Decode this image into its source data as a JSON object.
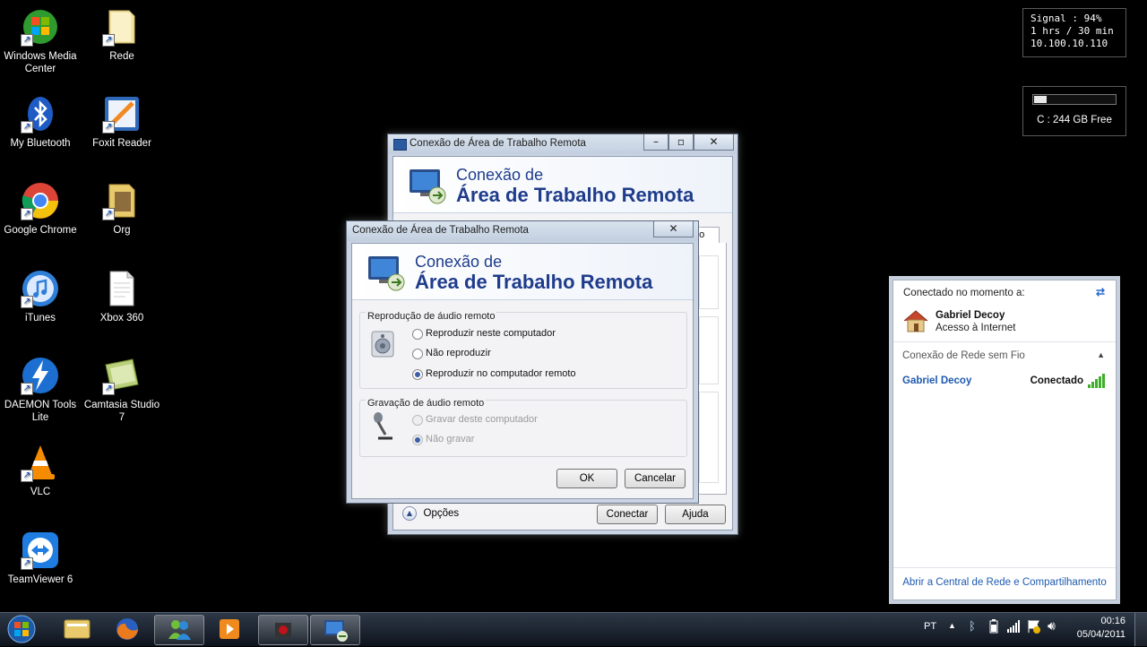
{
  "desktop": {
    "icons": [
      {
        "label": "Windows Media\nCenter",
        "icon": "windows-media-center-icon"
      },
      {
        "label": "Rede",
        "icon": "network-folder-icon"
      },
      {
        "label": "My Bluetooth",
        "icon": "bluetooth-icon"
      },
      {
        "label": "Foxit Reader",
        "icon": "foxit-reader-icon"
      },
      {
        "label": "Google Chrome",
        "icon": "chrome-icon"
      },
      {
        "label": "Org",
        "icon": "folder-icon"
      },
      {
        "label": "iTunes",
        "icon": "itunes-icon"
      },
      {
        "label": "Xbox 360",
        "icon": "document-icon"
      },
      {
        "label": "DAEMON Tools\nLite",
        "icon": "daemon-tools-icon"
      },
      {
        "label": "Camtasia Studio\n7",
        "icon": "camtasia-icon"
      },
      {
        "label": "VLC",
        "icon": "vlc-icon"
      },
      {
        "label": "TeamViewer 6",
        "icon": "teamviewer-icon"
      }
    ]
  },
  "gadgets": {
    "network": {
      "line1": "Signal : 94%",
      "line2": "1 hrs / 30 min",
      "line3": "10.100.10.110"
    },
    "drive": {
      "label": "C : 244 GB Free",
      "usage_fraction": 0.15
    }
  },
  "rdp_back": {
    "title": "Conexão de Área de Trabalho Remota",
    "banner_line1": "Conexão de",
    "banner_line2": "Área de Trabalho Remota",
    "tab_partial": "do",
    "options_label": "Opções",
    "connect_label": "Conectar",
    "help_label": "Ajuda"
  },
  "rdp_dialog": {
    "title": "Conexão de Área de Trabalho Remota",
    "banner_line1": "Conexão de",
    "banner_line2": "Área de Trabalho Remota",
    "playback": {
      "title": "Reprodução de áudio remoto",
      "options": [
        "Reproduzir neste computador",
        "Não reproduzir",
        "Reproduzir no computador remoto"
      ],
      "selected": 2
    },
    "recording": {
      "title": "Gravação de áudio remoto",
      "options": [
        "Gravar deste computador",
        "Não gravar"
      ],
      "selected": 1
    },
    "ok_label": "OK",
    "cancel_label": "Cancelar"
  },
  "network_flyout": {
    "header": "Conectado no momento a:",
    "network_name": "Gabriel Decoy",
    "network_access": "Acesso à Internet",
    "section_title": "Conexão de Rede sem Fio",
    "wifi_name": "Gabriel Decoy",
    "wifi_status": "Conectado",
    "footer_link": "Abrir a Central de Rede e Compartilhamento"
  },
  "taskbar": {
    "language": "PT",
    "time": "00:16",
    "date": "05/04/2011"
  }
}
